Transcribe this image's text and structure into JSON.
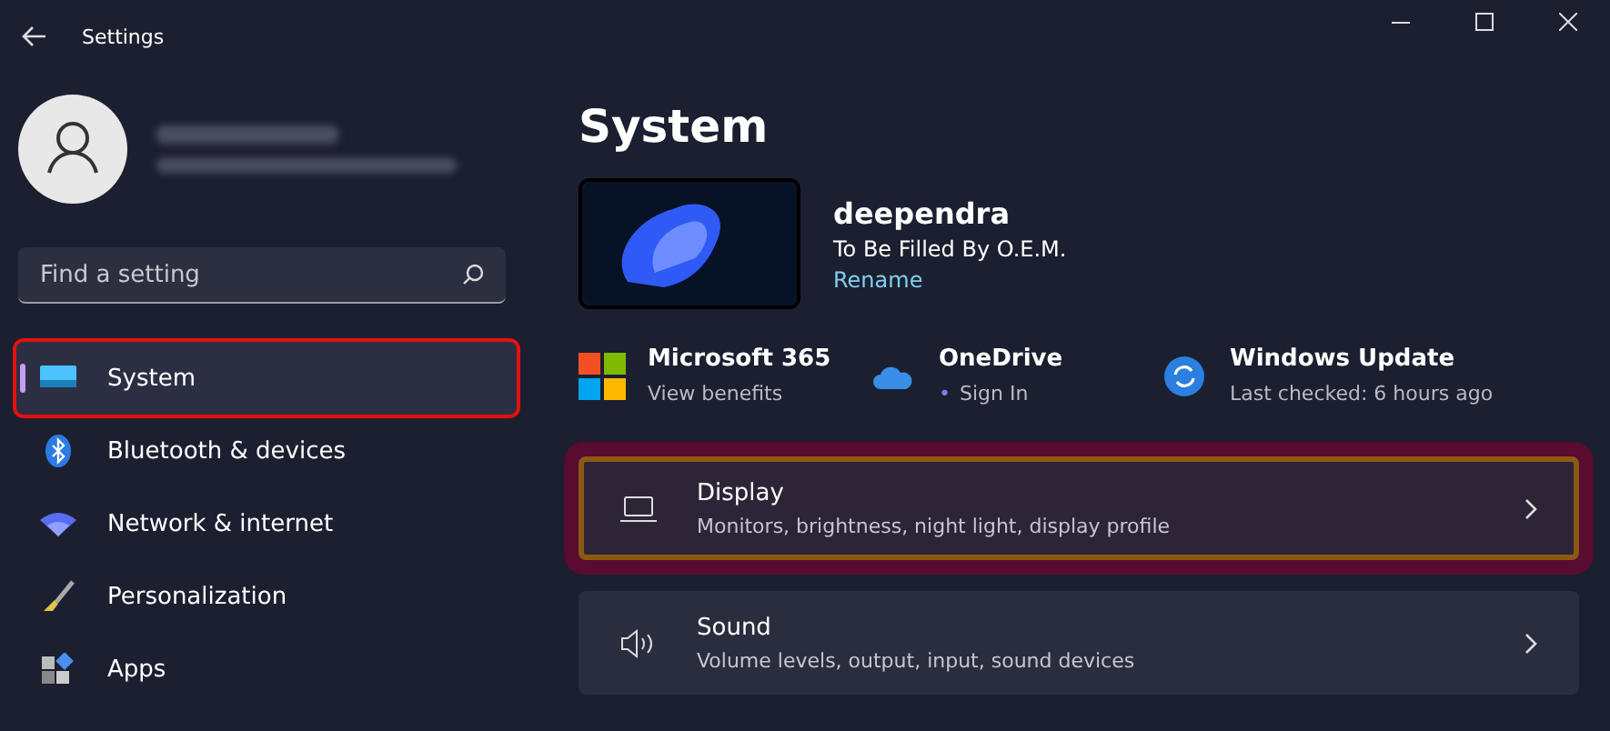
{
  "window": {
    "title": "Settings"
  },
  "search": {
    "placeholder": "Find a setting"
  },
  "sidebar": {
    "items": [
      {
        "label": "System",
        "kind": "system",
        "selected": true,
        "highlighted": true
      },
      {
        "label": "Bluetooth & devices",
        "kind": "bluetooth",
        "selected": false,
        "highlighted": false
      },
      {
        "label": "Network & internet",
        "kind": "network",
        "selected": false,
        "highlighted": false
      },
      {
        "label": "Personalization",
        "kind": "brush",
        "selected": false,
        "highlighted": false
      },
      {
        "label": "Apps",
        "kind": "apps",
        "selected": false,
        "highlighted": false
      }
    ]
  },
  "page_title": "System",
  "device": {
    "name": "deependra",
    "model": "To Be Filled By O.E.M.",
    "rename": "Rename"
  },
  "quick_links": [
    {
      "kind": "office",
      "title": "Microsoft 365",
      "subtitle": "View benefits"
    },
    {
      "kind": "cloud",
      "title": "OneDrive",
      "subtitle": "Sign In",
      "bullet": "•"
    },
    {
      "kind": "update",
      "title": "Windows Update",
      "subtitle": "Last checked: 6 hours ago"
    }
  ],
  "cards": [
    {
      "kind": "display",
      "title": "Display",
      "subtitle": "Monitors, brightness, night light, display profile",
      "highlighted": true
    },
    {
      "kind": "sound",
      "title": "Sound",
      "subtitle": "Volume levels, output, input, sound devices",
      "highlighted": false
    }
  ]
}
